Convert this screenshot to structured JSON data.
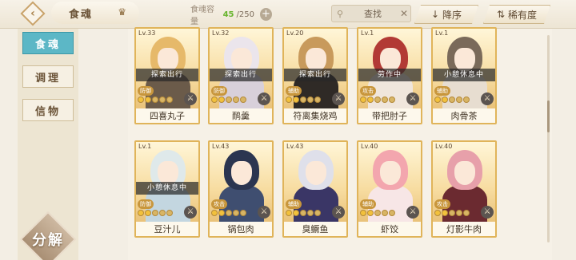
{
  "header": {
    "tab_title": "食魂",
    "capacity_label": "食魂容量",
    "capacity_current": "45",
    "capacity_max": "/250",
    "search_label": "查找",
    "sort_label": "降序",
    "rarity_label": "稀有度"
  },
  "sidebar": {
    "tabs": [
      {
        "label": "食魂",
        "active": true
      },
      {
        "label": "调理",
        "active": false
      },
      {
        "label": "信物",
        "active": false
      }
    ],
    "decompose_label": "分解"
  },
  "cards": [
    {
      "level": "Lv.33",
      "status": "探索出行",
      "role": "防御",
      "name": "四喜丸子",
      "hair": "#e6b96a",
      "body": "#6b5b4a"
    },
    {
      "level": "Lv.32",
      "status": "探索出行",
      "role": "防御",
      "name": "鸸羹",
      "hair": "#ebe5ec",
      "body": "#d8d0da"
    },
    {
      "level": "Lv.20",
      "status": "探索出行",
      "role": "辅助",
      "name": "符离集烧鸡",
      "hair": "#c89a5c",
      "body": "#2f2a26"
    },
    {
      "level": "Lv.1",
      "status": "劳作中",
      "role": "攻击",
      "name": "带把肘子",
      "hair": "#b23a35",
      "body": "#f0e6dc"
    },
    {
      "level": "Lv.1",
      "status": "小憩休息中",
      "role": "辅助",
      "name": "肉骨茶",
      "hair": "#7a6a5a",
      "body": "#e7ddd0"
    },
    {
      "level": "Lv.1",
      "status": "小憩休息中",
      "role": "防御",
      "name": "豆汁儿",
      "hair": "#dfe9ea",
      "body": "#c3d6e0"
    },
    {
      "level": "Lv.43",
      "status": "",
      "role": "攻击",
      "name": "锅包肉",
      "hair": "#2b3550",
      "body": "#3f4e70"
    },
    {
      "level": "Lv.43",
      "status": "",
      "role": "辅助",
      "name": "臭鳜鱼",
      "hair": "#dfe0ea",
      "body": "#3a3666"
    },
    {
      "level": "Lv.40",
      "status": "",
      "role": "辅助",
      "name": "虾饺",
      "hair": "#f3a6ae",
      "body": "#f7e6e6"
    },
    {
      "level": "Lv.40",
      "status": "",
      "role": "攻击",
      "name": "灯影牛肉",
      "hair": "#e7a0aa",
      "body": "#6b2a30"
    }
  ]
}
